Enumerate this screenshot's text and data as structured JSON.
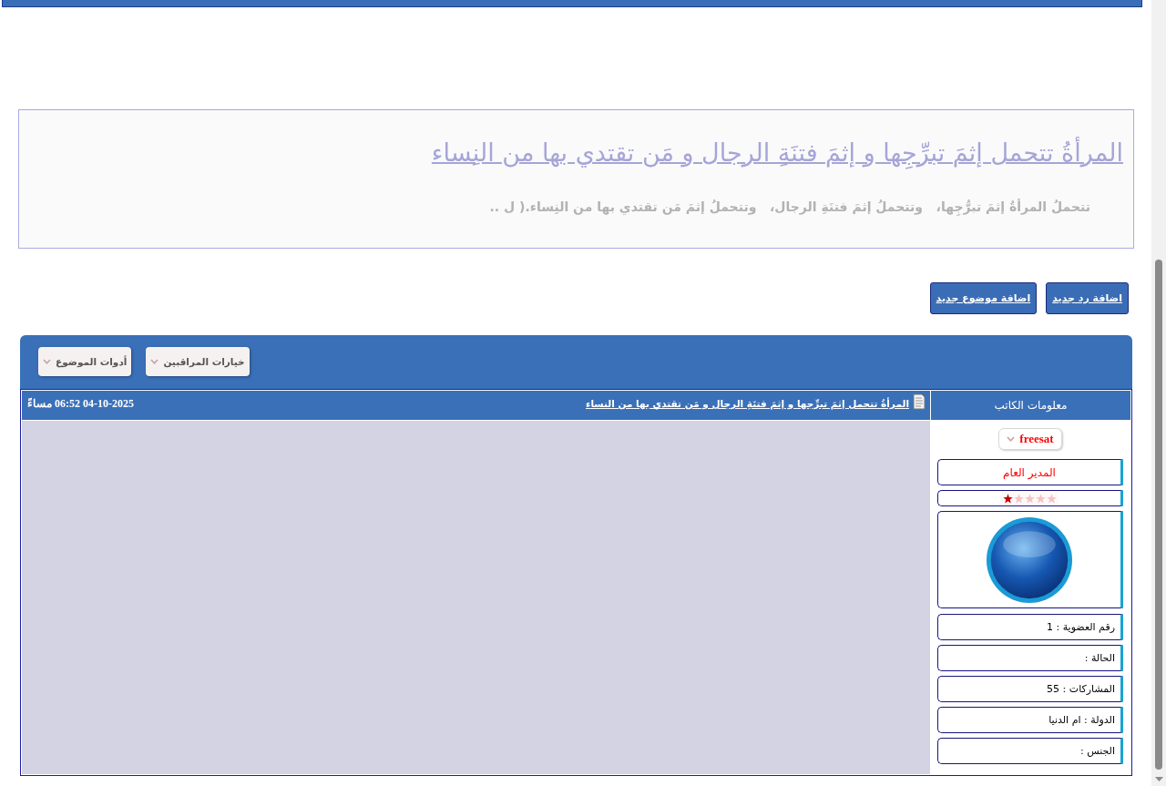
{
  "topic": {
    "title": "المرأةُ تتحمل إثمَ تبرِّجِها و إثمَ فتنَةِ الرجال و مَن تقتدي بها من النِساء",
    "excerpt": "تتحملُ المرأةُ إثمَ تبرُّجِها،   وتتحملُ إثمَ فتنَةِ الرجال،   وتتحملُ إثمَ مَن تقتدي بها من النِساء.( ل .."
  },
  "actions": [
    {
      "label": "اضافة رد جديد"
    },
    {
      "label": "اضافة موضوع جديد"
    }
  ],
  "toolbar": {
    "menus": [
      {
        "label": "خيارات المراقبين"
      },
      {
        "label": "أدوات الموضوع"
      }
    ]
  },
  "post": {
    "author_heading": "معلومات الكاتب",
    "title": "المرأةُ تتحمل إثمَ تبرِّجها و إثمَ فتنَةِ الرجال و مَن تقتدي بها من النساء",
    "date": "04-10-2025 06:52 مساءً",
    "author": {
      "username": "freesat",
      "rank": "المدير العام",
      "stars": 1,
      "details": [
        "رقم العضوية : 1",
        "الحالة :",
        "المشاركات : 55",
        "الدولة : ام الدنيا",
        "الجنس :"
      ]
    }
  }
}
